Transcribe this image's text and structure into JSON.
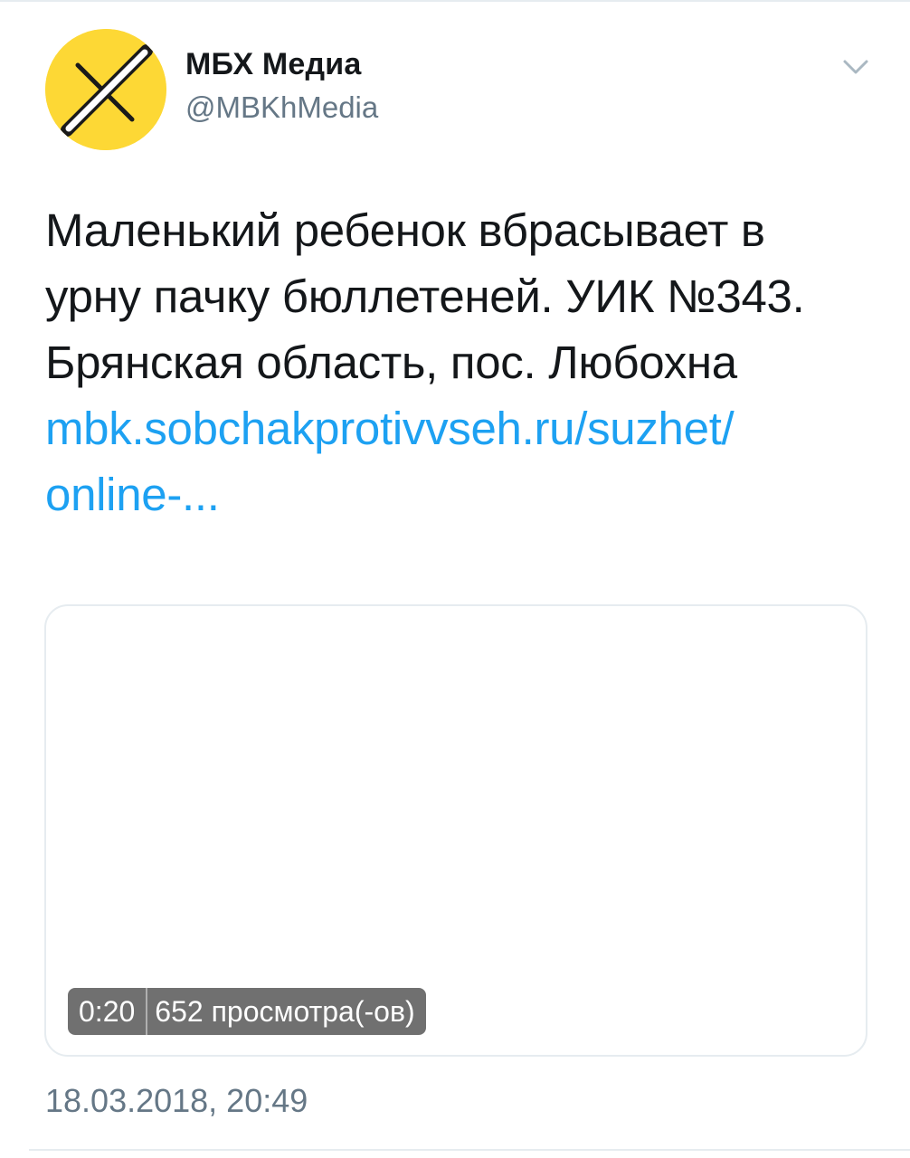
{
  "tweet": {
    "display_name": "МБХ Медиа",
    "handle": "@MBKhMedia",
    "text_lines": [
      "Маленький ребенок вбрасывает в",
      "урну пачку бюллетеней. УИК №343.",
      "Брянская область, пос. Любохна"
    ],
    "link_lines": [
      "mbk.sobchakprotivvseh.ru/suzhet/",
      "online-..."
    ],
    "video": {
      "duration": "0:20",
      "views": "652 просмотра(-ов)"
    },
    "timestamp": "18.03.2018, 20:49"
  },
  "icons": {
    "avatar": "mbkh-logo-icon",
    "menu": "chevron-down-icon"
  },
  "colors": {
    "avatar_bg": "#fdd835",
    "link": "#1da1f2",
    "secondary_text": "#657786",
    "primary_text": "#14171a",
    "divider": "#e6ecf0"
  }
}
